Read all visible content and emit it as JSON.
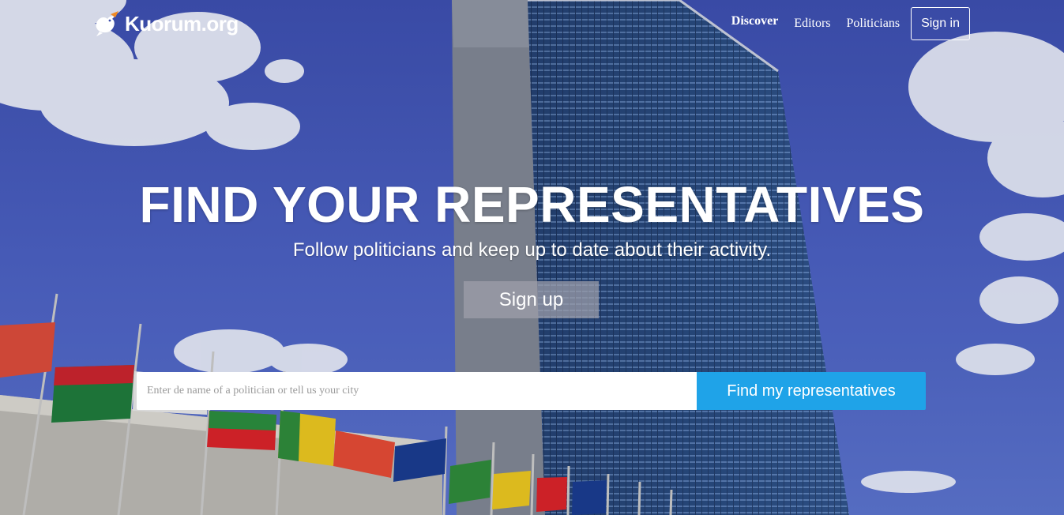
{
  "header": {
    "logo_text": "Kuorum.org",
    "nav": {
      "discover": "Discover",
      "editors": "Editors",
      "politicians": "Politicians",
      "sign_in": "Sign in"
    }
  },
  "hero": {
    "title": "FIND YOUR REPRESENTATIVES",
    "subtitle": "Follow politicians and keep up to date about their activity.",
    "signup_label": "Sign up"
  },
  "search": {
    "placeholder": "Enter de name of a politician or tell us your city",
    "value": "",
    "button_label": "Find my representatives"
  },
  "colors": {
    "accent": "#1fa3e8",
    "logo_orange": "#f08a24"
  },
  "icons": {
    "logo": "bird-icon"
  }
}
